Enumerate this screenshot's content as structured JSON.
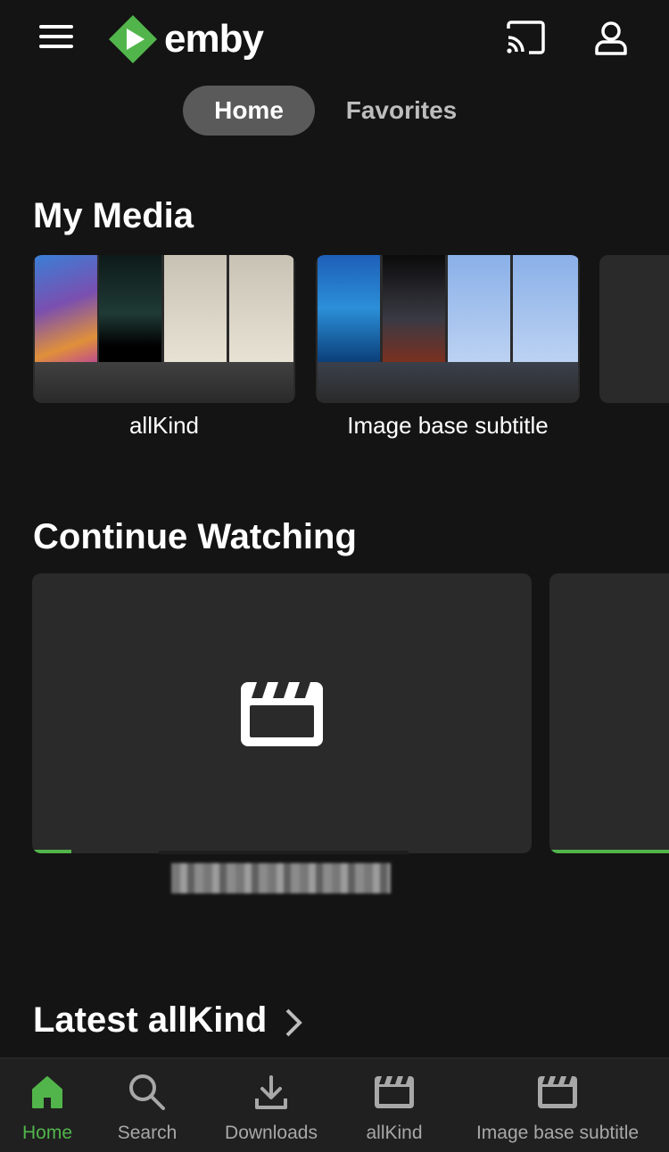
{
  "header": {
    "brand": "emby",
    "menu_icon": "hamburger-menu-icon",
    "cast_icon": "cast-icon",
    "user_icon": "user-icon"
  },
  "tabs": [
    {
      "label": "Home",
      "active": true
    },
    {
      "label": "Favorites",
      "active": false
    }
  ],
  "my_media": {
    "title": "My Media",
    "libraries": [
      {
        "label": "allKind"
      },
      {
        "label": "Image base subtitle"
      }
    ]
  },
  "continue_watching": {
    "title": "Continue Watching",
    "items": [
      {
        "icon": "movie-clapper-icon",
        "progress": 0.08
      },
      {
        "progress": 1.0
      }
    ]
  },
  "latest": {
    "title": "Latest allKind"
  },
  "bottom_nav": [
    {
      "label": "Home",
      "icon": "home-icon",
      "active": true
    },
    {
      "label": "Search",
      "icon": "search-icon",
      "active": false
    },
    {
      "label": "Downloads",
      "icon": "download-icon",
      "active": false
    },
    {
      "label": "allKind",
      "icon": "clapper-icon",
      "active": false
    },
    {
      "label": "Image base subtitle",
      "icon": "clapper-icon",
      "active": false
    }
  ],
  "colors": {
    "accent": "#52b54b",
    "background": "#141414",
    "card": "#2a2a2a"
  }
}
